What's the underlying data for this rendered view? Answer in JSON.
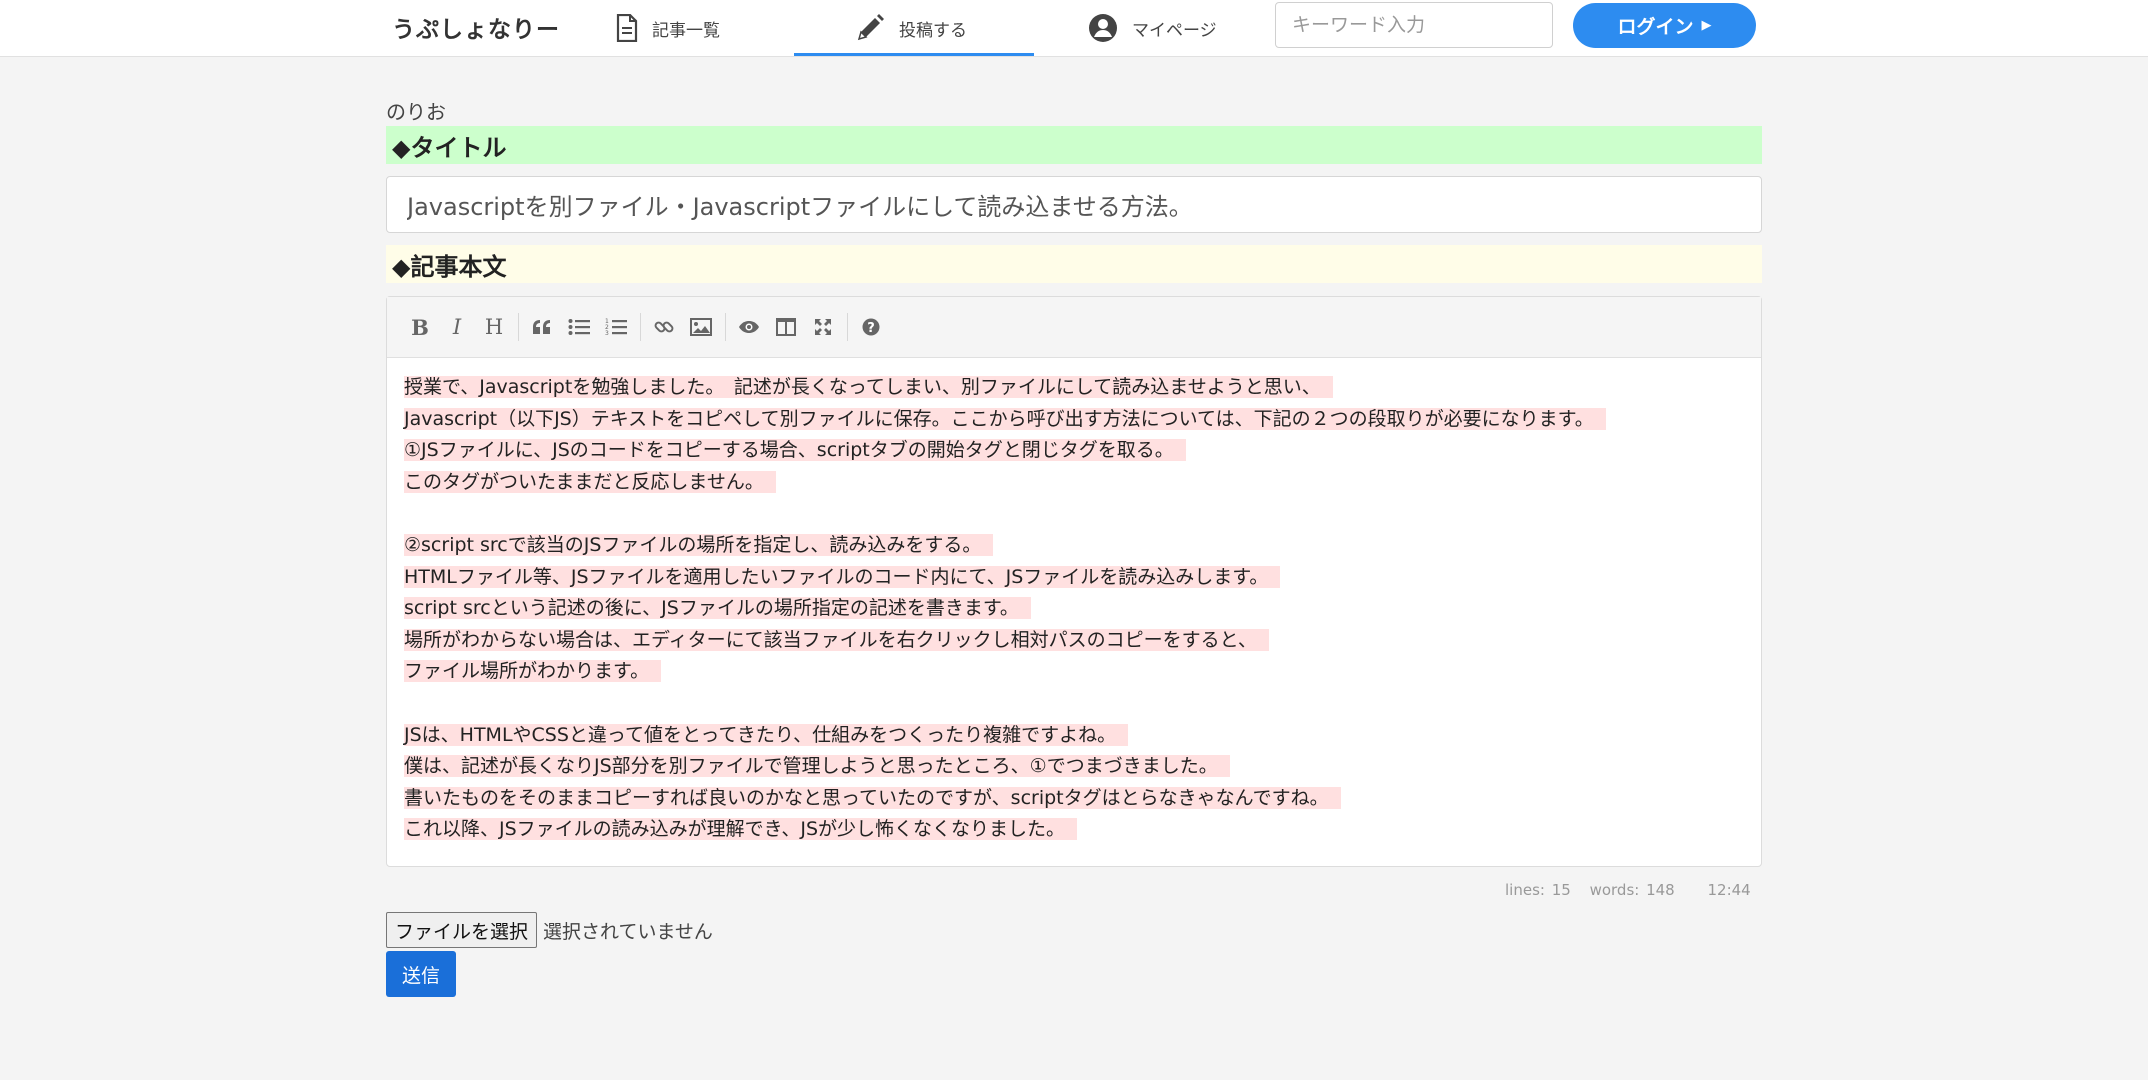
{
  "header": {
    "logo": "うぷしょなりー",
    "nav": [
      {
        "label": "記事一覧",
        "icon": "document-icon"
      },
      {
        "label": "投稿する",
        "icon": "pencil-icon",
        "active": true
      },
      {
        "label": "マイページ",
        "icon": "user-circle-icon"
      }
    ],
    "search_placeholder": "キーワード入力",
    "login_label": "ログイン"
  },
  "main": {
    "author": "のりお",
    "title_label": "◆タイトル",
    "title_value": "Javascriptを別ファイル・Javascriptファイルにして読み込ませる方法。",
    "body_label": "◆記事本文",
    "toolbar": [
      "bold-icon",
      "italic-icon",
      "heading-icon",
      "quote-icon",
      "unordered-list-icon",
      "ordered-list-icon",
      "link-icon",
      "image-icon",
      "preview-icon",
      "side-by-side-icon",
      "fullscreen-icon",
      "help-icon"
    ],
    "body_lines": [
      "授業で、Javascriptを勉強しました。　記述が長くなってしまい、別ファイルにして読み込ませようと思い、",
      "Javascript（以下JS）テキストをコピペして別ファイルに保存。ここから呼び出す方法については、下記の２つの段取りが必要になります。",
      "①JSファイルに、JSのコードをコピーする場合、scriptタブの開始タグと閉じタグを取る。",
      "このタグがついたままだと反応しません。",
      "",
      "②script srcで該当のJSファイルの場所を指定し、読み込みをする。",
      "HTMLファイル等、JSファイルを適用したいファイルのコード内にて、JSファイルを読み込みします。",
      "script srcという記述の後に、JSファイルの場所指定の記述を書きます。",
      "場所がわからない場合は、エディターにて該当ファイルを右クリックし相対パスのコピーをすると、",
      "ファイル場所がわかります。",
      "",
      "JSは、HTMLやCSSと違って値をとってきたり、仕組みをつくったり複雑ですよね。",
      "僕は、記述が長くなりJS部分を別ファイルで管理しようと思ったところ、①でつまづきました。",
      "書いたものをそのままコピーすれば良いのかなと思っていたのですが、scriptタグはとらなきゃなんですね。",
      "これ以降、JSファイルの読み込みが理解でき、JSが少し怖くなくなりました。"
    ],
    "status": {
      "lines": "lines: 15",
      "words": "words: 148",
      "time": "12:44"
    },
    "file_button": "ファイルを選択",
    "file_status": "選択されていません",
    "submit_label": "送信"
  },
  "colors": {
    "accent": "#2d8cf0",
    "title_bg": "#ccffcc",
    "body_bg": "#fffde8",
    "highlight": "#ffe0e0",
    "submit": "#1a6fd9"
  }
}
